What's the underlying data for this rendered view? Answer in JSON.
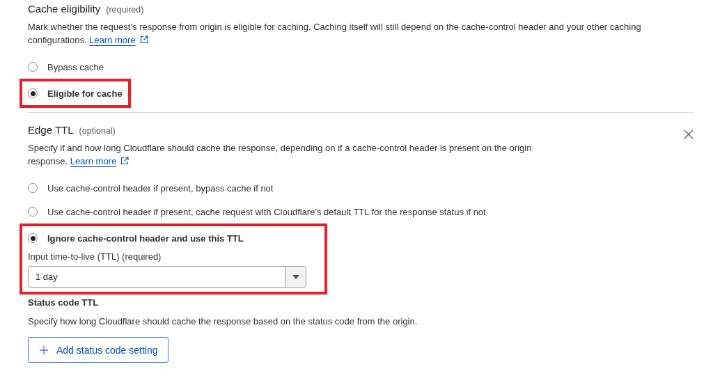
{
  "sections": [
    {
      "title": "Cache eligibility",
      "qualifier": "(required)",
      "description": "Mark whether the request’s response from origin is eligible for caching. Caching itself will still depend on the cache-control header and your other caching configurations.",
      "link": "Learn more",
      "removable": false,
      "options": [
        {
          "label": "Bypass cache",
          "selected": false,
          "highlighted": false
        },
        {
          "label": "Eligible for cache",
          "selected": true,
          "highlighted": true
        }
      ]
    },
    {
      "title": "Edge TTL",
      "qualifier": "(optional)",
      "description": "Specify if and how long Cloudflare should cache the response, depending on if a cache-control header is present on the origin response.",
      "link": "Learn more",
      "removable": true,
      "options": [
        {
          "label": "Use cache-control header if present, bypass cache if not",
          "selected": false,
          "highlighted": false
        },
        {
          "label": "Use cache-control header if present, cache request with Cloudflare's default TTL for the response status if not",
          "selected": false,
          "highlighted": false
        },
        {
          "label": "Ignore cache-control header and use this TTL",
          "selected": true,
          "highlighted": true,
          "ttl": {
            "label": "Input time-to-live (TTL) (required)",
            "value": "1 day"
          }
        }
      ],
      "status_code": {
        "title": "Status code TTL",
        "description": "Specify how long Cloudflare should cache the response based on the status code from the origin.",
        "button": "Add status code setting"
      }
    }
  ]
}
